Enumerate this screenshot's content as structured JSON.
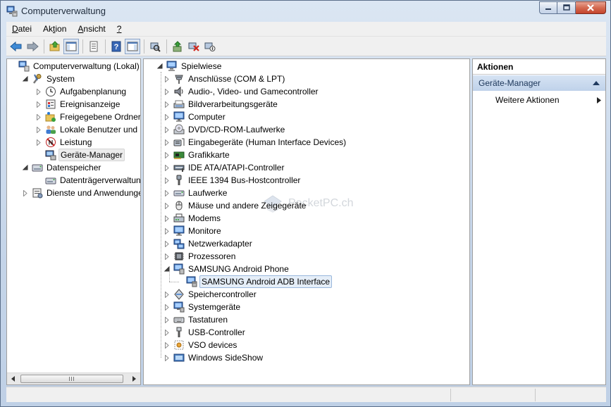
{
  "window": {
    "title": "Computerverwaltung"
  },
  "menu": [
    {
      "pre": "",
      "u": "D",
      "post": "atei"
    },
    {
      "pre": "Ak",
      "u": "t",
      "post": "ion"
    },
    {
      "pre": "",
      "u": "A",
      "post": "nsicht"
    },
    {
      "pre": "",
      "u": "?",
      "post": ""
    }
  ],
  "left_tree": [
    {
      "label": "Computerverwaltung (Lokal)",
      "icon": "computer-management-icon",
      "level": 0,
      "expander": "none"
    },
    {
      "label": "System",
      "icon": "system-tools-icon",
      "level": 1,
      "expander": "expanded"
    },
    {
      "label": "Aufgabenplanung",
      "icon": "clock-icon",
      "level": 2,
      "expander": "collapsed"
    },
    {
      "label": "Ereignisanzeige",
      "icon": "event-viewer-icon",
      "level": 2,
      "expander": "collapsed"
    },
    {
      "label": "Freigegebene Ordner",
      "icon": "shared-folder-icon",
      "level": 2,
      "expander": "collapsed"
    },
    {
      "label": "Lokale Benutzer und Gr",
      "icon": "users-icon",
      "level": 2,
      "expander": "collapsed"
    },
    {
      "label": "Leistung",
      "icon": "performance-icon",
      "level": 2,
      "expander": "collapsed"
    },
    {
      "label": "Geräte-Manager",
      "icon": "device-manager-icon",
      "level": 2,
      "expander": "none",
      "selected": true
    },
    {
      "label": "Datenspeicher",
      "icon": "storage-icon",
      "level": 1,
      "expander": "expanded"
    },
    {
      "label": "Datenträgerverwaltung",
      "icon": "disk-management-icon",
      "level": 2,
      "expander": "none"
    },
    {
      "label": "Dienste und Anwendungen",
      "icon": "services-icon",
      "level": 1,
      "expander": "collapsed"
    }
  ],
  "device_tree": {
    "root": "Spielwiese",
    "items": [
      {
        "label": "Anschlüsse (COM & LPT)",
        "icon": "port-icon"
      },
      {
        "label": "Audio-, Video- und Gamecontroller",
        "icon": "speaker-icon"
      },
      {
        "label": "Bildverarbeitungsgeräte",
        "icon": "scanner-icon"
      },
      {
        "label": "Computer",
        "icon": "monitor-icon"
      },
      {
        "label": "DVD/CD-ROM-Laufwerke",
        "icon": "dvd-drive-icon"
      },
      {
        "label": "Eingabegeräte (Human Interface Devices)",
        "icon": "hid-icon"
      },
      {
        "label": "Grafikkarte",
        "icon": "display-adapter-icon"
      },
      {
        "label": "IDE ATA/ATAPI-Controller",
        "icon": "ide-controller-icon"
      },
      {
        "label": "IEEE 1394 Bus-Hostcontroller",
        "icon": "firewire-icon"
      },
      {
        "label": "Laufwerke",
        "icon": "disk-drive-icon"
      },
      {
        "label": "Mäuse und andere Zeigegeräte",
        "icon": "mouse-icon"
      },
      {
        "label": "Modems",
        "icon": "modem-icon"
      },
      {
        "label": "Monitore",
        "icon": "monitor-icon"
      },
      {
        "label": "Netzwerkadapter",
        "icon": "network-adapter-icon"
      },
      {
        "label": "Prozessoren",
        "icon": "processor-icon"
      },
      {
        "label": "SAMSUNG Android Phone",
        "icon": "phone-device-icon",
        "expanded": true,
        "child": {
          "label": "SAMSUNG Android ADB Interface",
          "icon": "adb-interface-icon"
        }
      },
      {
        "label": "Speichercontroller",
        "icon": "storage-controller-icon"
      },
      {
        "label": "Systemgeräte",
        "icon": "system-devices-icon"
      },
      {
        "label": "Tastaturen",
        "icon": "keyboard-icon"
      },
      {
        "label": "USB-Controller",
        "icon": "usb-icon"
      },
      {
        "label": "VSO devices",
        "icon": "vso-device-icon"
      },
      {
        "label": "Windows SideShow",
        "icon": "sideshow-icon"
      }
    ]
  },
  "watermark": "PocketPC.ch",
  "actions": {
    "header": "Aktionen",
    "group": "Geräte-Manager",
    "item": "Weitere Aktionen"
  },
  "colors": {
    "selection": "#e5eef8",
    "selection_border": "#99b7dc",
    "accent": "#1b3558"
  }
}
